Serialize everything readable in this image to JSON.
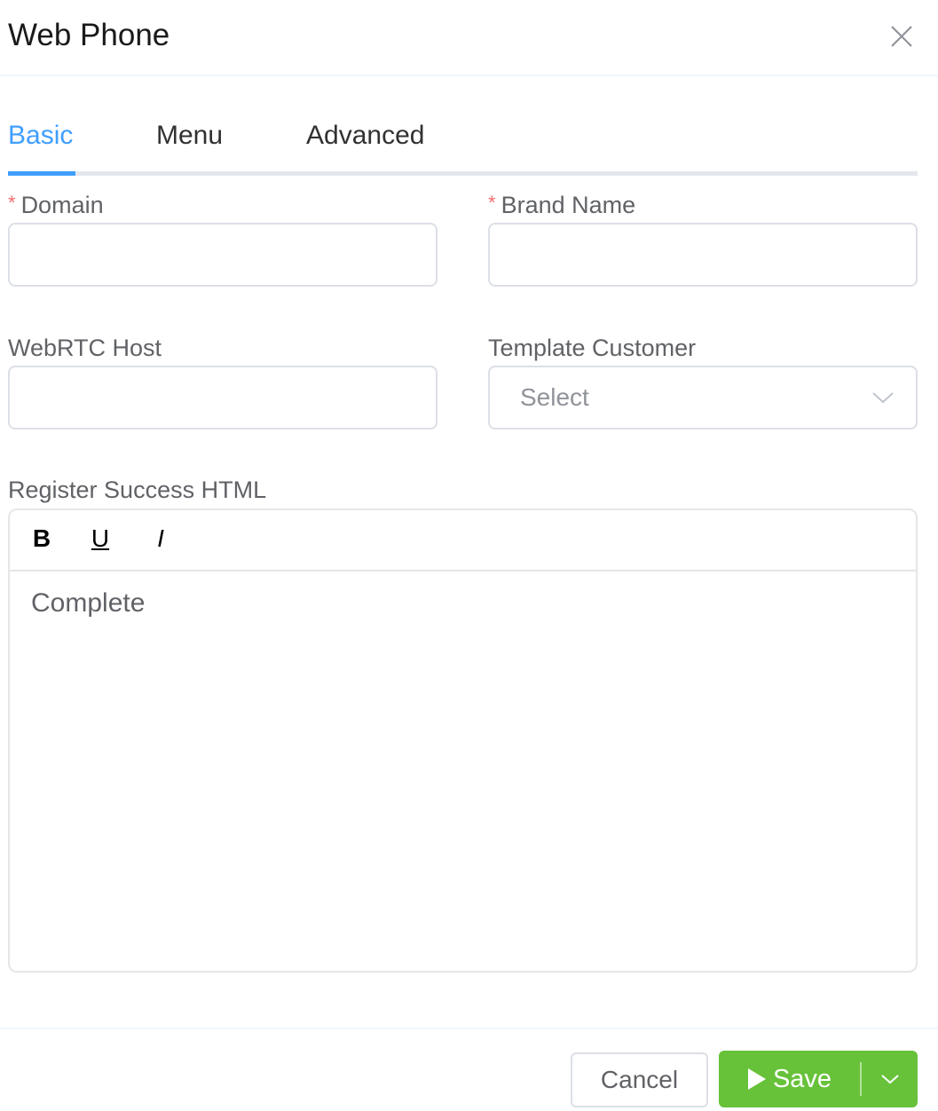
{
  "dialog": {
    "title": "Web Phone",
    "close_icon": "close-icon"
  },
  "tabs": [
    {
      "label": "Basic",
      "active": true
    },
    {
      "label": "Menu",
      "active": false
    },
    {
      "label": "Advanced",
      "active": false
    }
  ],
  "form": {
    "domain": {
      "label": "Domain",
      "required_mark": "*",
      "value": "",
      "placeholder": ""
    },
    "brand_name": {
      "label": "Brand Name",
      "required_mark": "*",
      "value": "",
      "placeholder": ""
    },
    "webrtc_host": {
      "label": "WebRTC Host",
      "value": "",
      "placeholder": ""
    },
    "template_customer": {
      "label": "Template Customer",
      "placeholder": "Select",
      "selected": ""
    },
    "register_success_html": {
      "label": "Register Success HTML",
      "toolbar": {
        "bold": "B",
        "underline": "U",
        "italic": "I"
      },
      "content": "Complete"
    }
  },
  "footer": {
    "cancel_label": "Cancel",
    "save_label": "Save",
    "save_icon": "play-icon",
    "dropdown_icon": "chevron-down-icon"
  },
  "colors": {
    "accent": "#409eff",
    "success": "#67c23a",
    "required": "#f56c6c"
  }
}
